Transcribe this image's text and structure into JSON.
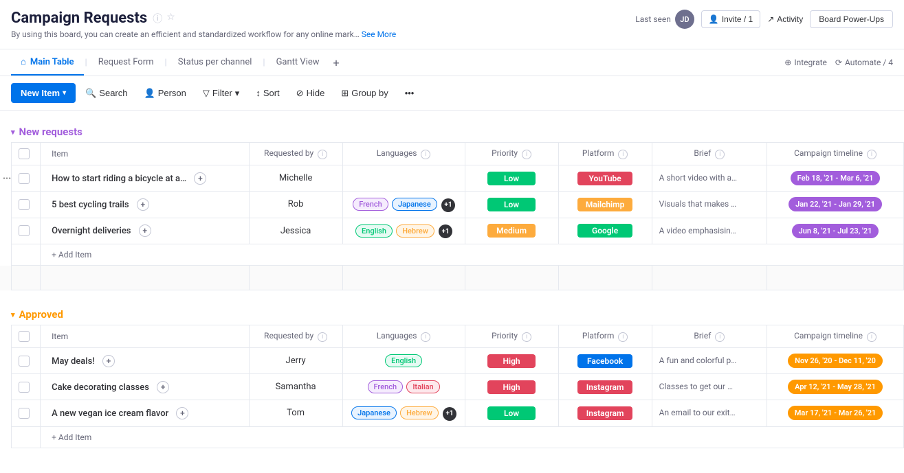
{
  "header": {
    "title": "Campaign Requests",
    "subtitle": "By using this board, you can create an efficient and standardized workflow for any online mark…",
    "subtitle_link": "See More",
    "last_seen_label": "Last seen",
    "invite_label": "Invite / 1",
    "activity_label": "Activity",
    "power_ups_label": "Board Power-Ups",
    "avatar_initials": "JD"
  },
  "tabs": {
    "items": [
      {
        "id": "main-table",
        "label": "Main Table",
        "icon": "home-icon",
        "active": true
      },
      {
        "id": "request-form",
        "label": "Request Form",
        "active": false
      },
      {
        "id": "status-per-channel",
        "label": "Status per channel",
        "active": false
      },
      {
        "id": "gantt-view",
        "label": "Gantt View",
        "active": false
      }
    ],
    "plus_label": "+",
    "integrate_label": "Integrate",
    "automate_label": "Automate / 4"
  },
  "toolbar": {
    "new_item_label": "New Item",
    "search_label": "Search",
    "person_label": "Person",
    "filter_label": "Filter",
    "sort_label": "Sort",
    "hide_label": "Hide",
    "group_by_label": "Group by"
  },
  "sections": {
    "new_requests": {
      "title": "New requests",
      "color": "#a25ddc",
      "columns": [
        "Item",
        "Requested by",
        "Languages",
        "Priority",
        "Platform",
        "Brief",
        "Campaign timeline"
      ],
      "rows": [
        {
          "item": "How to start riding a bicycle at a…",
          "requested_by": "Michelle",
          "languages": [],
          "priority": "Low",
          "priority_color": "low",
          "platform": "YouTube",
          "platform_color": "youtube",
          "brief": "A short video with a…",
          "timeline": "Feb 18, '21 - Mar 6, '21",
          "timeline_color": "purple"
        },
        {
          "item": "5 best cycling trails",
          "requested_by": "Rob",
          "languages": [
            "French",
            "Japanese"
          ],
          "languages_extra": "+1",
          "priority": "Low",
          "priority_color": "low",
          "platform": "Mailchimp",
          "platform_color": "mailchimp",
          "brief": "Visuals that makes …",
          "timeline": "Jan 22, '21 - Jan 29, '21",
          "timeline_color": "purple"
        },
        {
          "item": "Overnight deliveries",
          "requested_by": "Jessica",
          "languages": [
            "English",
            "Hebrew"
          ],
          "languages_extra": "+1",
          "priority": "Medium",
          "priority_color": "medium",
          "platform": "Google",
          "platform_color": "google",
          "brief": "A video emphasisin…",
          "timeline": "Jun 8, '21 - Jul 23, '21",
          "timeline_color": "purple"
        }
      ],
      "add_item_label": "+ Add Item"
    },
    "approved": {
      "title": "Approved",
      "color": "#ff9900",
      "columns": [
        "Item",
        "Requested by",
        "Languages",
        "Priority",
        "Platform",
        "Brief",
        "Campaign timeline"
      ],
      "rows": [
        {
          "item": "May deals!",
          "requested_by": "Jerry",
          "languages": [
            "English"
          ],
          "languages_extra": null,
          "priority": "High",
          "priority_color": "high",
          "platform": "Facebook",
          "platform_color": "facebook",
          "brief": "A fun and colorful p…",
          "timeline": "Nov 26, '20 - Dec 11, '20",
          "timeline_color": "orange"
        },
        {
          "item": "Cake decorating classes",
          "requested_by": "Samantha",
          "languages": [
            "French",
            "Italian"
          ],
          "languages_extra": null,
          "priority": "High",
          "priority_color": "high",
          "platform": "Instagram",
          "platform_color": "instagram",
          "brief": "Classes to get our …",
          "timeline": "Apr 12, '21 - May 28, '21",
          "timeline_color": "orange"
        },
        {
          "item": "A new vegan ice cream flavor",
          "requested_by": "Tom",
          "languages": [
            "Japanese",
            "Hebrew"
          ],
          "languages_extra": "+1",
          "priority": "Low",
          "priority_color": "low",
          "platform": "Instagram",
          "platform_color": "instagram",
          "brief": "An email to our exit…",
          "timeline": "Mar 17, '21 - Mar 26, '21",
          "timeline_color": "orange"
        }
      ],
      "add_item_label": "+ Add Item"
    }
  },
  "lang_classes": {
    "French": "lang-french",
    "Japanese": "lang-japanese",
    "English": "lang-english",
    "Hebrew": "lang-hebrew",
    "Italian": "lang-italian"
  }
}
